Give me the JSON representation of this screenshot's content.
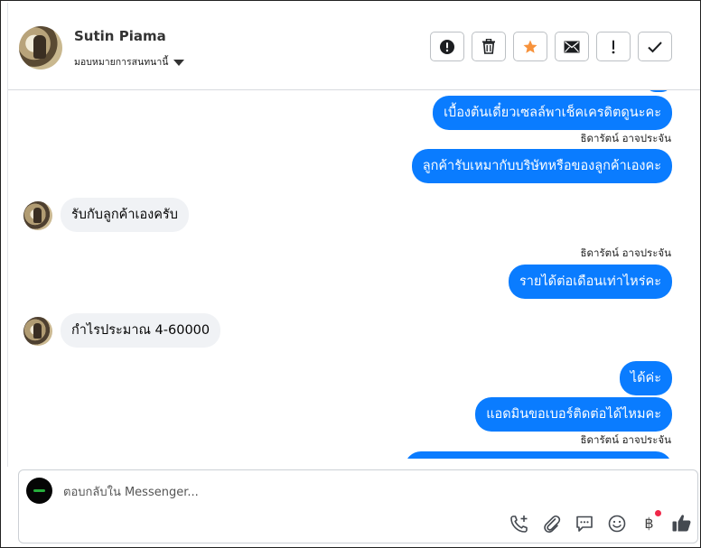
{
  "contact": {
    "name": "Sutin Piama",
    "assign_label": "มอบหมายการสนทนานี้"
  },
  "toolbar": {
    "buttons": [
      {
        "name": "mark-spam-button",
        "icon": "exclamation-circle-icon"
      },
      {
        "name": "delete-button",
        "icon": "trash-icon"
      },
      {
        "name": "star-button",
        "icon": "star-icon",
        "color": "#f7923b"
      },
      {
        "name": "mark-unread-button",
        "icon": "envelope-icon"
      },
      {
        "name": "follow-up-button",
        "icon": "exclamation-icon"
      },
      {
        "name": "mark-done-button",
        "icon": "checkmark-icon"
      }
    ]
  },
  "messages": {
    "m1": "เบื้องต้นเดี๋ยวเซลล์พาเช็คเครดิตดูนะคะ",
    "sender1": "ธิดารัตน์ อาจประจัน",
    "m2": "ลูกค้ารับเหมากับบริษัทหรือของลูกค้าเองคะ",
    "m3": "รับกับลูกค้าเองครับ",
    "sender2": "ธิดารัตน์ อาจประจัน",
    "m4": "รายได้ต่อเดือนเท่าไหร่คะ",
    "m5": "กำไรประมาณ 4-60000",
    "m6": "ได้ค่ะ",
    "m7": "แอดมินขอเบอร์ติดต่อได้ไหมคะ",
    "sender3": "ธิดารัตน์ อาจประจัน"
  },
  "reply": {
    "placeholder": "ตอบกลับใน Messenger..."
  },
  "colors": {
    "outgoing_bubble": "#0a7cff",
    "incoming_bubble": "#f0f2f5",
    "star": "#f7923b",
    "notification": "#f02849",
    "like": "#444950"
  }
}
